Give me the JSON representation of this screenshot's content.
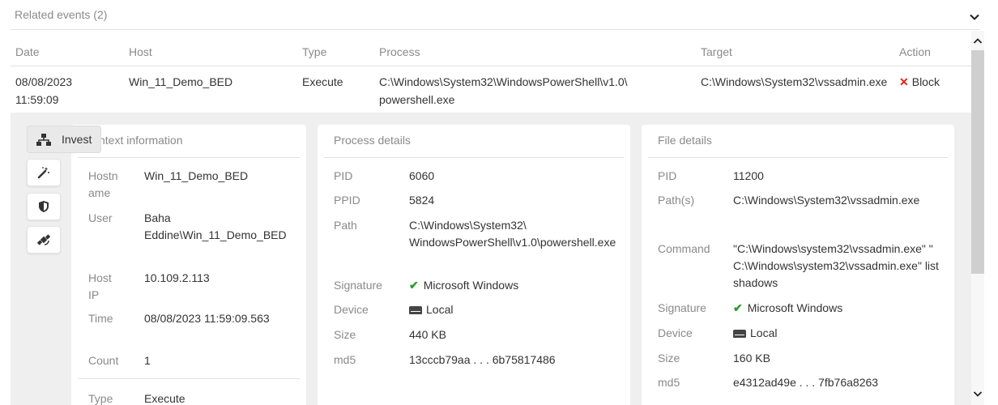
{
  "header": {
    "title": "Related events (2)"
  },
  "table": {
    "columns": [
      "Date",
      "Host",
      "Type",
      "Process",
      "Target",
      "Action"
    ],
    "row": {
      "date_line1": "08/08/2023",
      "date_line2": "11:59:09",
      "host": "Win_11_Demo_BED",
      "type": "Execute",
      "process_line1": "C:\\Windows\\System32\\WindowsPowerShell\\v1.0\\",
      "process_line2": "powershell.exe",
      "target": "C:\\Windows\\System32\\vssadmin.exe",
      "action": "Block"
    }
  },
  "toolbar": {
    "invest_label": "Invest"
  },
  "context": {
    "title": "ntext information",
    "hostname_label_1": "Hostn",
    "hostname_label_2": "ame",
    "hostname": "Win_11_Demo_BED",
    "user_label": "User",
    "user_line1": "Baha",
    "user_line2": "Eddine\\Win_11_Demo_BED",
    "hostip_label_1": "Host",
    "hostip_label_2": "IP",
    "hostip": "10.109.2.113",
    "time_label": "Time",
    "time": "08/08/2023 11:59:09.563",
    "count_label": "Count",
    "count": "1",
    "type_label": "Type",
    "type": "Execute"
  },
  "process": {
    "title": "Process details",
    "pid_label": "PID",
    "pid": "6060",
    "ppid_label": "PPID",
    "ppid": "5824",
    "path_label": "Path",
    "path_line1": "C:\\Windows\\System32\\",
    "path_line2": "WindowsPowerShell\\v1.0\\powershell.exe",
    "signature_label": "Signature",
    "signature": "Microsoft Windows",
    "device_label": "Device",
    "device": "Local",
    "size_label": "Size",
    "size": "440 KB",
    "md5_label": "md5",
    "md5": "13cccb79aa . . . 6b75817486"
  },
  "file": {
    "title": "File details",
    "pid_label": "PID",
    "pid": "11200",
    "paths_label": "Path(s)",
    "paths": "C:\\Windows\\System32\\vssadmin.exe",
    "command_label": "Command",
    "command_line1": "\"C:\\Windows\\system32\\vssadmin.exe\" \"",
    "command_line2": "C:\\Windows\\system32\\vssadmin.exe\" list",
    "command_line3": "shadows",
    "signature_label": "Signature",
    "signature": "Microsoft Windows",
    "device_label": "Device",
    "device": "Local",
    "size_label": "Size",
    "size": "160 KB",
    "md5_label": "md5",
    "md5": "e4312ad49e . . . 7fb76a8263"
  }
}
